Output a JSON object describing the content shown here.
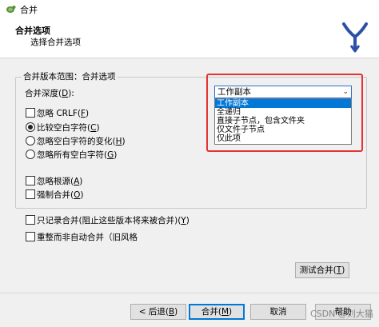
{
  "window": {
    "title": "合并"
  },
  "header": {
    "title": "合并选项",
    "subtitle": "选择合并选项"
  },
  "group": {
    "title": "合并版本范围：合并选项",
    "depth_label": "合并深度(",
    "depth_key": "D",
    "depth_suffix": "):",
    "combo_value": "工作副本",
    "dropdown_options": [
      "工作副本",
      "全递归",
      "直接子节点，包含文件夹",
      "仅文件子节点",
      "仅此项"
    ]
  },
  "options": {
    "ignore_crlf": {
      "text": "忽略 CRLF(",
      "key": "F",
      "suffix": ")",
      "checked": false
    },
    "whitespace": [
      {
        "text": "比较空白字符(",
        "key": "C",
        "suffix": ")",
        "checked": true
      },
      {
        "text": "忽略空白字符的变化(",
        "key": "H",
        "suffix": ")",
        "checked": false
      },
      {
        "text": "忽略所有空白字符(",
        "key": "G",
        "suffix": ")",
        "checked": false
      }
    ],
    "ignore_ancestry": {
      "text": "忽略根源(",
      "key": "A",
      "suffix": ")",
      "checked": false
    },
    "force_merge": {
      "text": "强制合并(",
      "key": "O",
      "suffix": ")",
      "checked": false
    },
    "record_only": {
      "text": "只记录合并(阻止这些版本将来被合并)(",
      "key": "Y",
      "suffix": ")",
      "checked": false
    },
    "reintegrate": {
      "text": "重整而非自动合并（旧风格",
      "checked": false
    }
  },
  "buttons": {
    "test_merge": {
      "text": "测试合并(",
      "key": "T",
      "suffix": ")"
    },
    "back": {
      "text": "< 后退(",
      "key": "B",
      "suffix": ")"
    },
    "merge": {
      "text": "合并(",
      "key": "M",
      "suffix": ")"
    },
    "cancel": "取消",
    "help": "帮助"
  },
  "watermark": "CSDN @刘大猫",
  "colors": {
    "accent": "#0078d7",
    "highlight_border": "#e53333",
    "logo": "#2d4fa8"
  },
  "icons": {
    "app": "tortoise-icon",
    "logo": "merge-arrows-logo",
    "combo": "chevron-down-icon"
  }
}
